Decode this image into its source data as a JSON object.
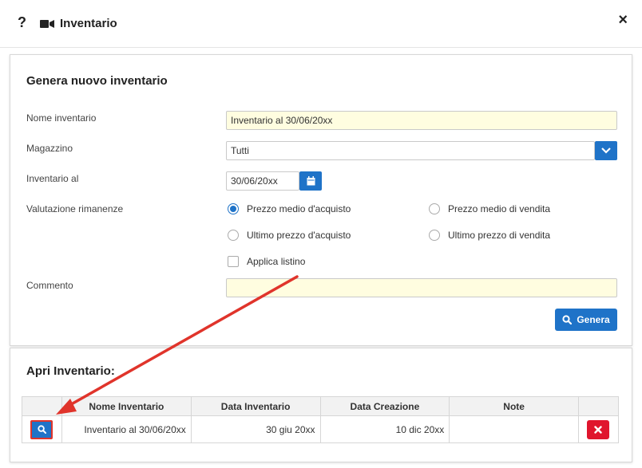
{
  "header": {
    "help": "?",
    "title": "Inventario",
    "close": "×"
  },
  "form": {
    "section_title": "Genera nuovo inventario",
    "nome_label": "Nome inventario",
    "nome_value": "Inventario al 30/06/20xx",
    "magazzino_label": "Magazzino",
    "magazzino_value": "Tutti",
    "data_label": "Inventario al",
    "data_value": "30/06/20xx",
    "valutazione_label": "Valutazione rimanenze",
    "radio": {
      "prezzo_medio_acquisto": "Prezzo medio d'acquisto",
      "prezzo_medio_vendita": "Prezzo medio di vendita",
      "ultimo_prezzo_acquisto": "Ultimo prezzo d'acquisto",
      "ultimo_prezzo_vendita": "Ultimo prezzo di vendita",
      "selected": "prezzo_medio_acquisto"
    },
    "applica_listino": "Applica listino",
    "commento_label": "Commento",
    "commento_value": "",
    "genera_button": "Genera"
  },
  "open": {
    "section_title": "Apri Inventario:",
    "columns": [
      "",
      "Nome Inventario",
      "Data Inventario",
      "Data Creazione",
      "Note",
      ""
    ],
    "rows": [
      {
        "nome": "Inventario al 30/06/20xx",
        "data_inventario": "30 giu 20xx",
        "data_creazione": "10 dic 20xx",
        "note": ""
      }
    ]
  },
  "colors": {
    "accent": "#1f73c8",
    "input_highlight": "#fffde0",
    "delete": "#e0152d",
    "annotation": "#e0342b"
  }
}
